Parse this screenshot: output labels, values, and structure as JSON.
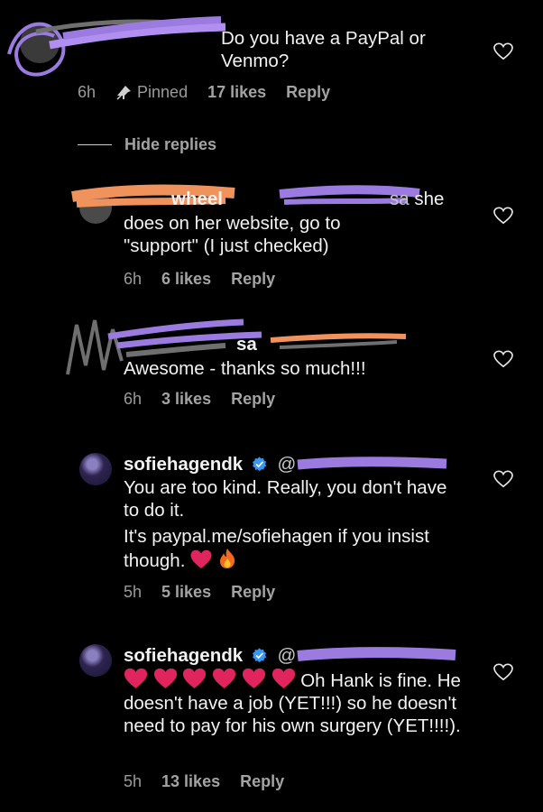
{
  "comments": [
    {
      "text": "Do you have a PayPal or Venmo?",
      "time": "6h",
      "pinned_label": "Pinned",
      "likes": "17 likes",
      "reply": "Reply"
    },
    {
      "username_tail": "wheel",
      "mention_tail": "sa",
      "text_first": "she",
      "text": "does on her website, go to \"support\" (I just checked)",
      "time": "6h",
      "likes": "6 likes",
      "reply": "Reply"
    },
    {
      "username_tail": "sa",
      "text": "Awesome - thanks so much!!!",
      "time": "6h",
      "likes": "3 likes",
      "reply": "Reply"
    },
    {
      "username": "sofiehagendk",
      "mention_prefix": "@",
      "text_line1": "You are too kind. Really, you don't have to do it.",
      "text_line2": "It's paypal.me/sofiehagen if you insist though.",
      "time": "5h",
      "likes": "5 likes",
      "reply": "Reply"
    },
    {
      "username": "sofiehagendk",
      "mention_prefix": "@",
      "text": "Oh Hank is fine. He doesn't have a job (YET!!!) so he doesn't need to pay for his own surgery (YET!!!!).",
      "time": "5h",
      "likes": "13 likes",
      "reply": "Reply"
    }
  ],
  "hide_replies": "Hide replies",
  "colors": {
    "background": "#000000",
    "text": "#f2f2f2",
    "meta": "#9a9a9a",
    "scribble_purple": "#9b7be0",
    "scribble_orange": "#f0925c",
    "verified": "#3897f0",
    "heart_red": "#e0245e"
  },
  "icons": [
    "heart-outline-icon",
    "pin-icon",
    "verified-badge-icon",
    "red-heart-emoji",
    "fire-emoji"
  ]
}
